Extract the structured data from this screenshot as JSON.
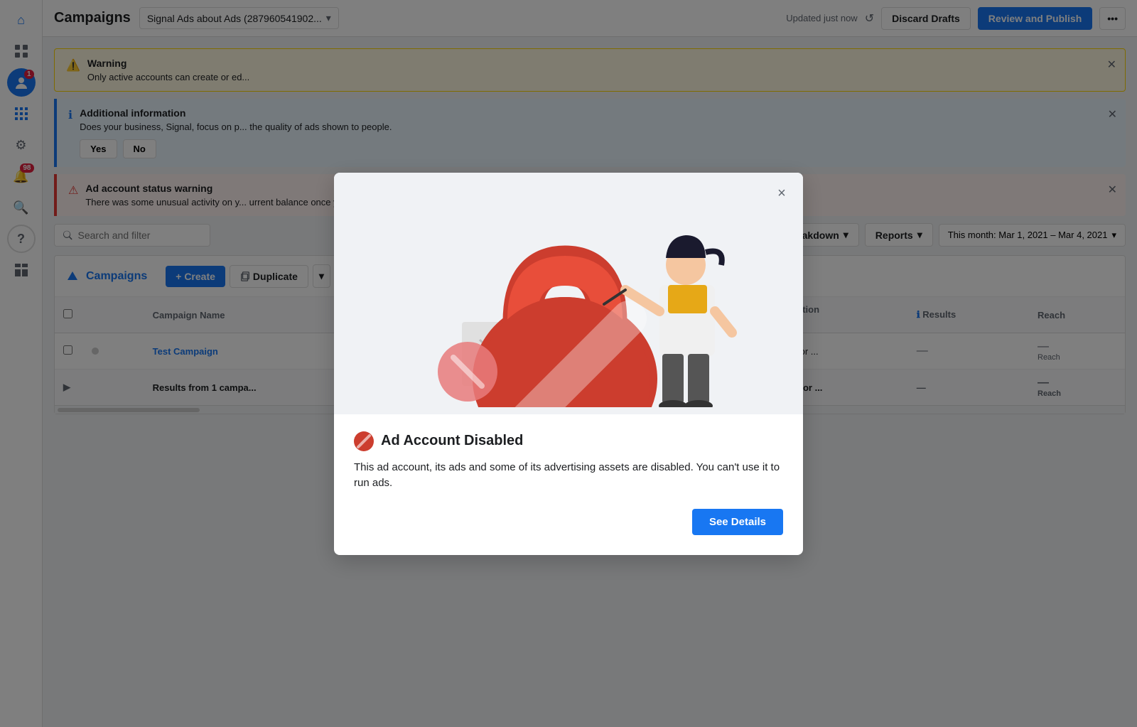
{
  "sidebar": {
    "icons": [
      {
        "name": "home-icon",
        "symbol": "⊞",
        "active": false
      },
      {
        "name": "apps-icon",
        "symbol": "⠿",
        "active": false
      },
      {
        "name": "profile-icon",
        "symbol": "●",
        "active": false,
        "badge": null
      },
      {
        "name": "notification-icon",
        "symbol": "🔔",
        "active": false,
        "badge": "98"
      },
      {
        "name": "search-icon",
        "symbol": "🔍",
        "active": false
      },
      {
        "name": "help-icon",
        "symbol": "?",
        "active": false
      },
      {
        "name": "grid-icon",
        "symbol": "▦",
        "active": true
      },
      {
        "name": "settings-icon",
        "symbol": "⚙",
        "active": false
      },
      {
        "name": "dashboard-icon",
        "symbol": "⊞",
        "active": false
      }
    ]
  },
  "header": {
    "title": "Campaigns",
    "account_name": "Signal Ads about Ads (287960541902...",
    "updated_text": "Updated just now",
    "discard_label": "Discard Drafts",
    "review_label": "Review and Publish"
  },
  "banners": [
    {
      "type": "warning",
      "title": "Warning",
      "text": "Only active accounts can create or ed..."
    },
    {
      "type": "info",
      "title": "Additional information",
      "text": "Does your business, Signal, focus on p... the quality of ads shown to people.",
      "actions": [
        "Yes",
        "No"
      ]
    },
    {
      "type": "error",
      "title": "Ad account status warning",
      "text": "There was some unusual activity on y... urrent balance once you verify your account with us."
    }
  ],
  "toolbar": {
    "search_placeholder": "Search and filter",
    "breakdown_label": "Breakdown",
    "reports_label": "Reports",
    "date_range": "This month: Mar 1, 2021 – Mar 4, 2021"
  },
  "campaigns_section": {
    "label": "Campaigns",
    "create_label": "+ Create",
    "duplicate_label": "Duplicate"
  },
  "table": {
    "columns": [
      "",
      "",
      "Campaign Name",
      "",
      "Attribution Setting",
      "Results",
      "Reach"
    ],
    "rows": [
      {
        "name": "Test Campaign",
        "attribution": "y click or ...",
        "results": "—",
        "reach": "—",
        "reach_label": "Reach"
      }
    ],
    "footer": {
      "label": "Results from 1 campa...",
      "attribution": "y click or ...",
      "results": "—",
      "reach": "—",
      "reach_label": "Reach"
    }
  },
  "modal": {
    "title": "Ad Account Disabled",
    "description": "This ad account, its ads and some of its advertising assets are disabled. You can't use it to run ads.",
    "see_details_label": "See Details",
    "close_label": "×"
  }
}
